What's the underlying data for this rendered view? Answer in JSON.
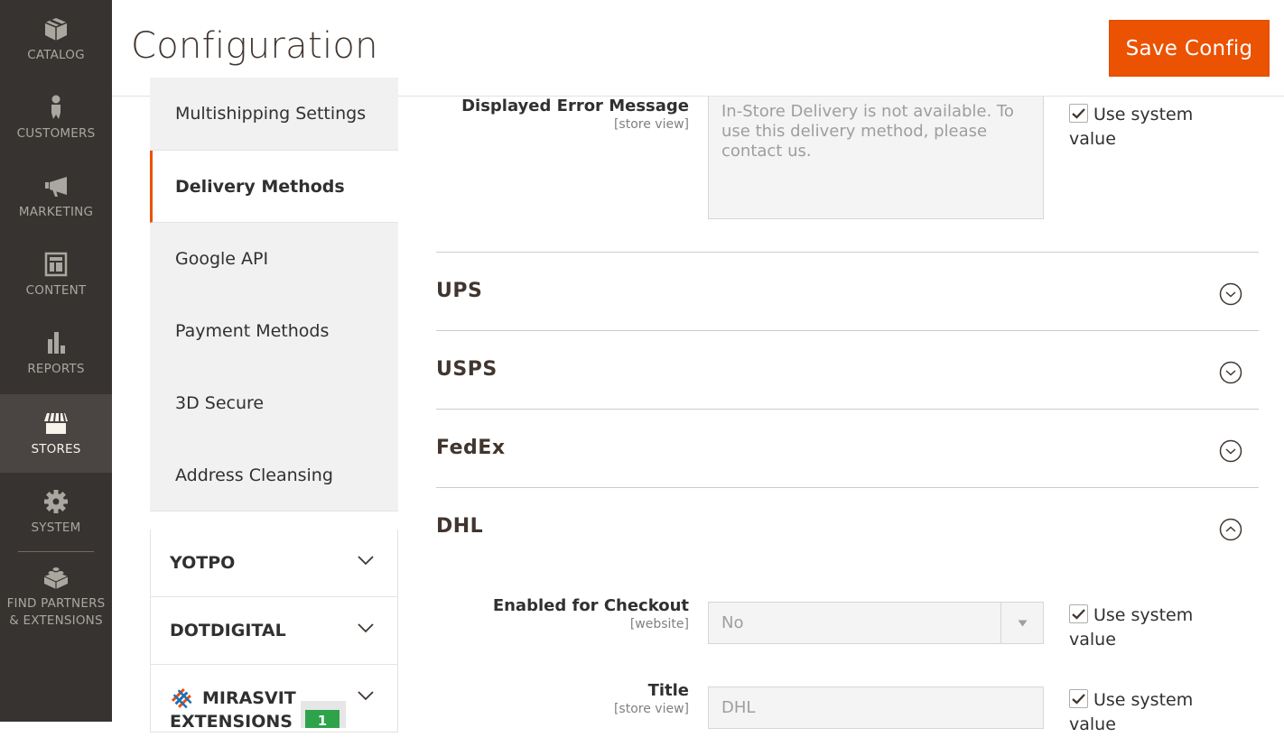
{
  "nav": {
    "items": [
      {
        "label": "CATALOG",
        "icon": "box-icon"
      },
      {
        "label": "CUSTOMERS",
        "icon": "person-icon"
      },
      {
        "label": "MARKETING",
        "icon": "megaphone-icon"
      },
      {
        "label": "CONTENT",
        "icon": "layout-icon"
      },
      {
        "label": "REPORTS",
        "icon": "bar-chart-icon"
      },
      {
        "label": "STORES",
        "icon": "storefront-icon",
        "active": true
      },
      {
        "label": "SYSTEM",
        "icon": "gear-icon"
      },
      {
        "label": "FIND PARTNERS & EXTENSIONS",
        "line1": "FIND PARTNERS",
        "line2": "& EXTENSIONS",
        "icon": "lego-brick-icon"
      }
    ]
  },
  "header": {
    "title": "Configuration",
    "save_label": "Save Config",
    "accent": "#eb5202"
  },
  "tabs": {
    "items": [
      {
        "label": "Multishipping Settings"
      },
      {
        "label": "Delivery Methods",
        "active": true
      },
      {
        "label": "Google API"
      },
      {
        "label": "Payment Methods"
      },
      {
        "label": "3D Secure"
      },
      {
        "label": "Address Cleansing"
      }
    ],
    "groups": [
      {
        "label": "YOTPO"
      },
      {
        "label": "DOTDIGITAL"
      },
      {
        "label": "MIRASVIT",
        "line2": "EXTENSIONS",
        "badge": "1"
      }
    ]
  },
  "main": {
    "error_field": {
      "label": "Displayed Error Message",
      "scope": "[store view]",
      "value": "In-Store Delivery is not available. To use this delivery method, please contact us.",
      "use_system": "Use system value",
      "checked": true
    },
    "sections": [
      {
        "title": "UPS",
        "expanded": false
      },
      {
        "title": "USPS",
        "expanded": false
      },
      {
        "title": "FedEx",
        "expanded": false
      },
      {
        "title": "DHL",
        "expanded": true
      }
    ],
    "dhl_fields": [
      {
        "label": "Enabled for Checkout",
        "scope": "[website]",
        "value": "No",
        "type": "select",
        "use_system": "Use system value",
        "checked": true
      },
      {
        "label": "Title",
        "scope": "[store view]",
        "value": "DHL",
        "type": "text",
        "use_system": "Use system value",
        "checked": true
      }
    ]
  }
}
